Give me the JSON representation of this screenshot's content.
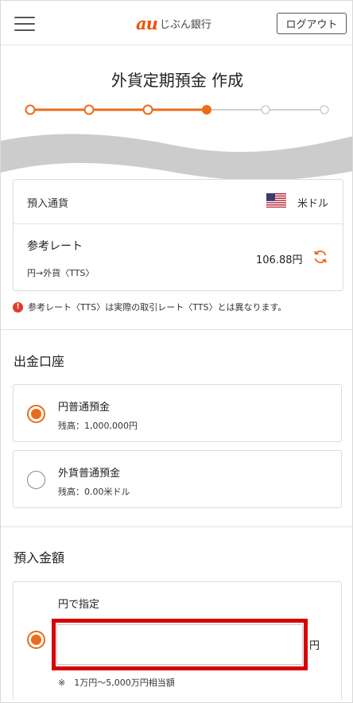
{
  "header": {
    "logo_brand": "au",
    "logo_bank": "じぶん銀行",
    "logout_label": "ログアウト"
  },
  "page": {
    "title": "外貨定期預金 作成"
  },
  "progress": {
    "total_steps": 6,
    "current_step": 4,
    "active_color": "#eb6c1b",
    "inactive_color": "#cccccc"
  },
  "deposit_currency": {
    "label": "預入通貨",
    "value": "米ドル",
    "flag_icon": "us-flag-icon"
  },
  "reference_rate": {
    "label": "参考レート",
    "type": "円→外貨〈TTS〉",
    "value": "106.88円",
    "refresh_icon": "refresh-icon"
  },
  "notice": {
    "text": "参考レート〈TTS〉は実際の取引レート〈TTS〉とは異なります。",
    "icon": "alert-icon"
  },
  "withdrawal": {
    "title": "出金口座",
    "options": [
      {
        "name": "円普通預金",
        "balance": "残高：1,000,000円",
        "selected": true
      },
      {
        "name": "外貨普通預金",
        "balance": "残高：0.00米ドル",
        "selected": false
      }
    ]
  },
  "amount": {
    "title": "預入金額",
    "mode_label": "円で指定",
    "input_value": "",
    "unit": "円",
    "note": "※　1万円〜5,000万円相当額",
    "selected": true
  },
  "colors": {
    "accent": "#eb6c1b",
    "brand": "#eb5505",
    "highlight": "#d80000",
    "alert": "#e23b2e"
  }
}
